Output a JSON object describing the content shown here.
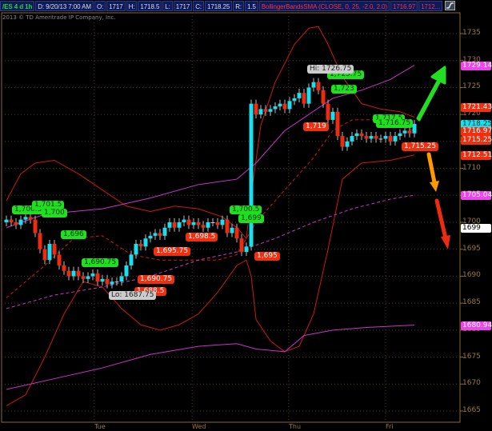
{
  "header": {
    "symbol": "/ES 4 d 1h",
    "date": "D: 9/20/13 7:00 AM",
    "open_label": "O:",
    "open": "1717",
    "high_label": "H:",
    "high": "1718.5",
    "low_label": "L:",
    "low": "1717",
    "close_label": "C:",
    "close": "1718.25",
    "range_label": "R:",
    "range": "1.5",
    "study": "BollingerBandsSMA (CLOSE, 0, 25, -2.0, 2.0)",
    "study_val1": "1716.97",
    "study_val2": "1712...",
    "style_button_icon": "chart-style-icon"
  },
  "copyright": "2013 © TD Ameritrade IP Company, Inc.",
  "colors": {
    "up": "#18e0f0",
    "down": "#ee2a10",
    "band": "#cc1a10",
    "sma": "#cc33cc",
    "green": "#1ee01e",
    "orange": "#ff9900"
  },
  "chart_data": {
    "type": "candlestick",
    "symbol": "/ES",
    "timeframe": "4 d 1h",
    "ylim": [
      1662,
      1738
    ],
    "y_ticks": [
      "1735",
      "1730",
      "1725",
      "1720",
      "1715",
      "1710",
      "1705",
      "1700",
      "1695",
      "1690",
      "1685",
      "1680",
      "1675",
      "1670",
      "1665"
    ],
    "x_ticks": [
      {
        "label": "Tue",
        "index": 18.3
      },
      {
        "label": "Wed",
        "index": 38.7
      },
      {
        "label": "Thu",
        "index": 58.8
      },
      {
        "label": "Fri",
        "index": 79
      }
    ],
    "closes": [
      1700.5,
      1700,
      1699.5,
      1700.5,
      1701,
      1700.5,
      1698,
      1695,
      1693,
      1696,
      1694,
      1692,
      1691,
      1690,
      1691,
      1690,
      1689.5,
      1690,
      1690.5,
      1689,
      1689.5,
      1688.5,
      1689,
      1689,
      1690,
      1692,
      1694,
      1696,
      1695.5,
      1697,
      1697.5,
      1698,
      1697.5,
      1699,
      1700,
      1699,
      1700,
      1700.5,
      1699.5,
      1700,
      1699.5,
      1699,
      1700,
      1700,
      1699.5,
      1700.5,
      1698,
      1699,
      1697,
      1694.5,
      1695.5,
      1722,
      1720,
      1721,
      1720.5,
      1721,
      1721.5,
      1722,
      1721,
      1722.5,
      1723,
      1724,
      1722,
      1725,
      1726,
      1724.5,
      1722,
      1719,
      1720.5,
      1716,
      1714,
      1715,
      1716,
      1716.5,
      1716,
      1715.5,
      1716,
      1715.5,
      1715.5,
      1716,
      1715,
      1716,
      1716.5,
      1717,
      1716.5,
      1718.25
    ],
    "first_open": 1700,
    "lines": [
      {
        "name": "bb-upper",
        "color": "#cc1a10",
        "dash": false,
        "points": [
          [
            0,
            1704
          ],
          [
            3,
            1709
          ],
          [
            6,
            1711
          ],
          [
            10,
            1711.5
          ],
          [
            15,
            1709
          ],
          [
            20,
            1706
          ],
          [
            25,
            1703
          ],
          [
            30,
            1702
          ],
          [
            35,
            1703
          ],
          [
            40,
            1702.5
          ],
          [
            45,
            1701
          ],
          [
            48,
            1699
          ],
          [
            50,
            1697
          ],
          [
            51,
            1705
          ],
          [
            53,
            1718
          ],
          [
            56,
            1726
          ],
          [
            60,
            1733
          ],
          [
            63,
            1736
          ],
          [
            65,
            1736.3
          ],
          [
            67,
            1733
          ],
          [
            70,
            1727
          ],
          [
            74,
            1722
          ],
          [
            78,
            1721
          ],
          [
            82,
            1720.5
          ],
          [
            85,
            1719.5
          ]
        ]
      },
      {
        "name": "bb-lower",
        "color": "#cc1a10",
        "dash": false,
        "points": [
          [
            0,
            1666
          ],
          [
            4,
            1668
          ],
          [
            8,
            1675
          ],
          [
            12,
            1683
          ],
          [
            16,
            1689
          ],
          [
            20,
            1688
          ],
          [
            24,
            1684
          ],
          [
            28,
            1681
          ],
          [
            32,
            1680
          ],
          [
            36,
            1681
          ],
          [
            40,
            1683
          ],
          [
            44,
            1687
          ],
          [
            48,
            1692
          ],
          [
            50,
            1693
          ],
          [
            51,
            1690
          ],
          [
            52,
            1682
          ],
          [
            55,
            1678
          ],
          [
            58,
            1676
          ],
          [
            61,
            1677
          ],
          [
            64,
            1683
          ],
          [
            67,
            1695
          ],
          [
            70,
            1708
          ],
          [
            74,
            1711
          ],
          [
            80,
            1711.5
          ],
          [
            85,
            1712.5
          ]
        ]
      },
      {
        "name": "bb-mid",
        "color": "#cc1a10",
        "dash": true,
        "points": [
          [
            0,
            1686
          ],
          [
            8,
            1692
          ],
          [
            14,
            1697
          ],
          [
            20,
            1697.5
          ],
          [
            26,
            1694
          ],
          [
            32,
            1693
          ],
          [
            38,
            1693
          ],
          [
            44,
            1693
          ],
          [
            48,
            1694
          ],
          [
            52,
            1700
          ],
          [
            58,
            1706
          ],
          [
            64,
            1712
          ],
          [
            68,
            1717
          ],
          [
            72,
            1719
          ],
          [
            78,
            1719
          ],
          [
            85,
            1716.97
          ]
        ]
      },
      {
        "name": "sma-upper",
        "color": "#cc33cc",
        "dash": false,
        "points": [
          [
            0,
            1699
          ],
          [
            8,
            1701.5
          ],
          [
            20,
            1702.5
          ],
          [
            30,
            1704.5
          ],
          [
            40,
            1707
          ],
          [
            48,
            1708
          ],
          [
            52,
            1711
          ],
          [
            58,
            1717
          ],
          [
            63,
            1720
          ],
          [
            68,
            1723
          ],
          [
            74,
            1724.5
          ],
          [
            80,
            1726.5
          ],
          [
            85,
            1729.14
          ]
        ]
      },
      {
        "name": "sma-mid",
        "color": "#cc33cc",
        "dash": true,
        "points": [
          [
            0,
            1684
          ],
          [
            10,
            1686.5
          ],
          [
            20,
            1688
          ],
          [
            30,
            1690
          ],
          [
            40,
            1693
          ],
          [
            48,
            1694.5
          ],
          [
            56,
            1697
          ],
          [
            64,
            1700
          ],
          [
            72,
            1702.5
          ],
          [
            80,
            1704.3
          ],
          [
            85,
            1705.04
          ]
        ]
      },
      {
        "name": "sma-lower",
        "color": "#cc33cc",
        "dash": false,
        "points": [
          [
            0,
            1669
          ],
          [
            10,
            1671
          ],
          [
            20,
            1673
          ],
          [
            30,
            1675.5
          ],
          [
            40,
            1677
          ],
          [
            48,
            1677.5
          ],
          [
            52,
            1676.5
          ],
          [
            58,
            1676
          ],
          [
            62,
            1679
          ],
          [
            68,
            1680
          ],
          [
            75,
            1680.5
          ],
          [
            85,
            1680.94
          ]
        ]
      }
    ],
    "callouts": {
      "green": [
        "1,700.5",
        "1,701.5",
        "1,700",
        "1,696",
        "1,690.75",
        "1,700.5",
        "1,699",
        "1,725.75",
        "1,723",
        "1,717.5",
        "1,716.75"
      ],
      "red": [
        "1,698.5",
        "1,695.75",
        "1,690.75",
        "1,688.5",
        "1,695",
        "1,719",
        "1,715.25"
      ],
      "hi": "Hi: 1726.75",
      "lo": "Lo: 1687.75"
    },
    "axis_tags": [
      {
        "value": "1729.14",
        "color": "#ee44ee"
      },
      {
        "value": "1721.43",
        "color": "#ee3010"
      },
      {
        "value": "1718.25",
        "color": "#18e0f0"
      },
      {
        "value": "1716.97",
        "color": "#ee3010"
      },
      {
        "value": "1715.25",
        "color": "#ee3010"
      },
      {
        "value": "1712.51",
        "color": "#ee3010"
      },
      {
        "value": "1705.04",
        "color": "#ee44ee"
      },
      {
        "value": "1699",
        "color": "#ffffff"
      },
      {
        "value": "1680.94",
        "color": "#ee44ee"
      }
    ]
  }
}
